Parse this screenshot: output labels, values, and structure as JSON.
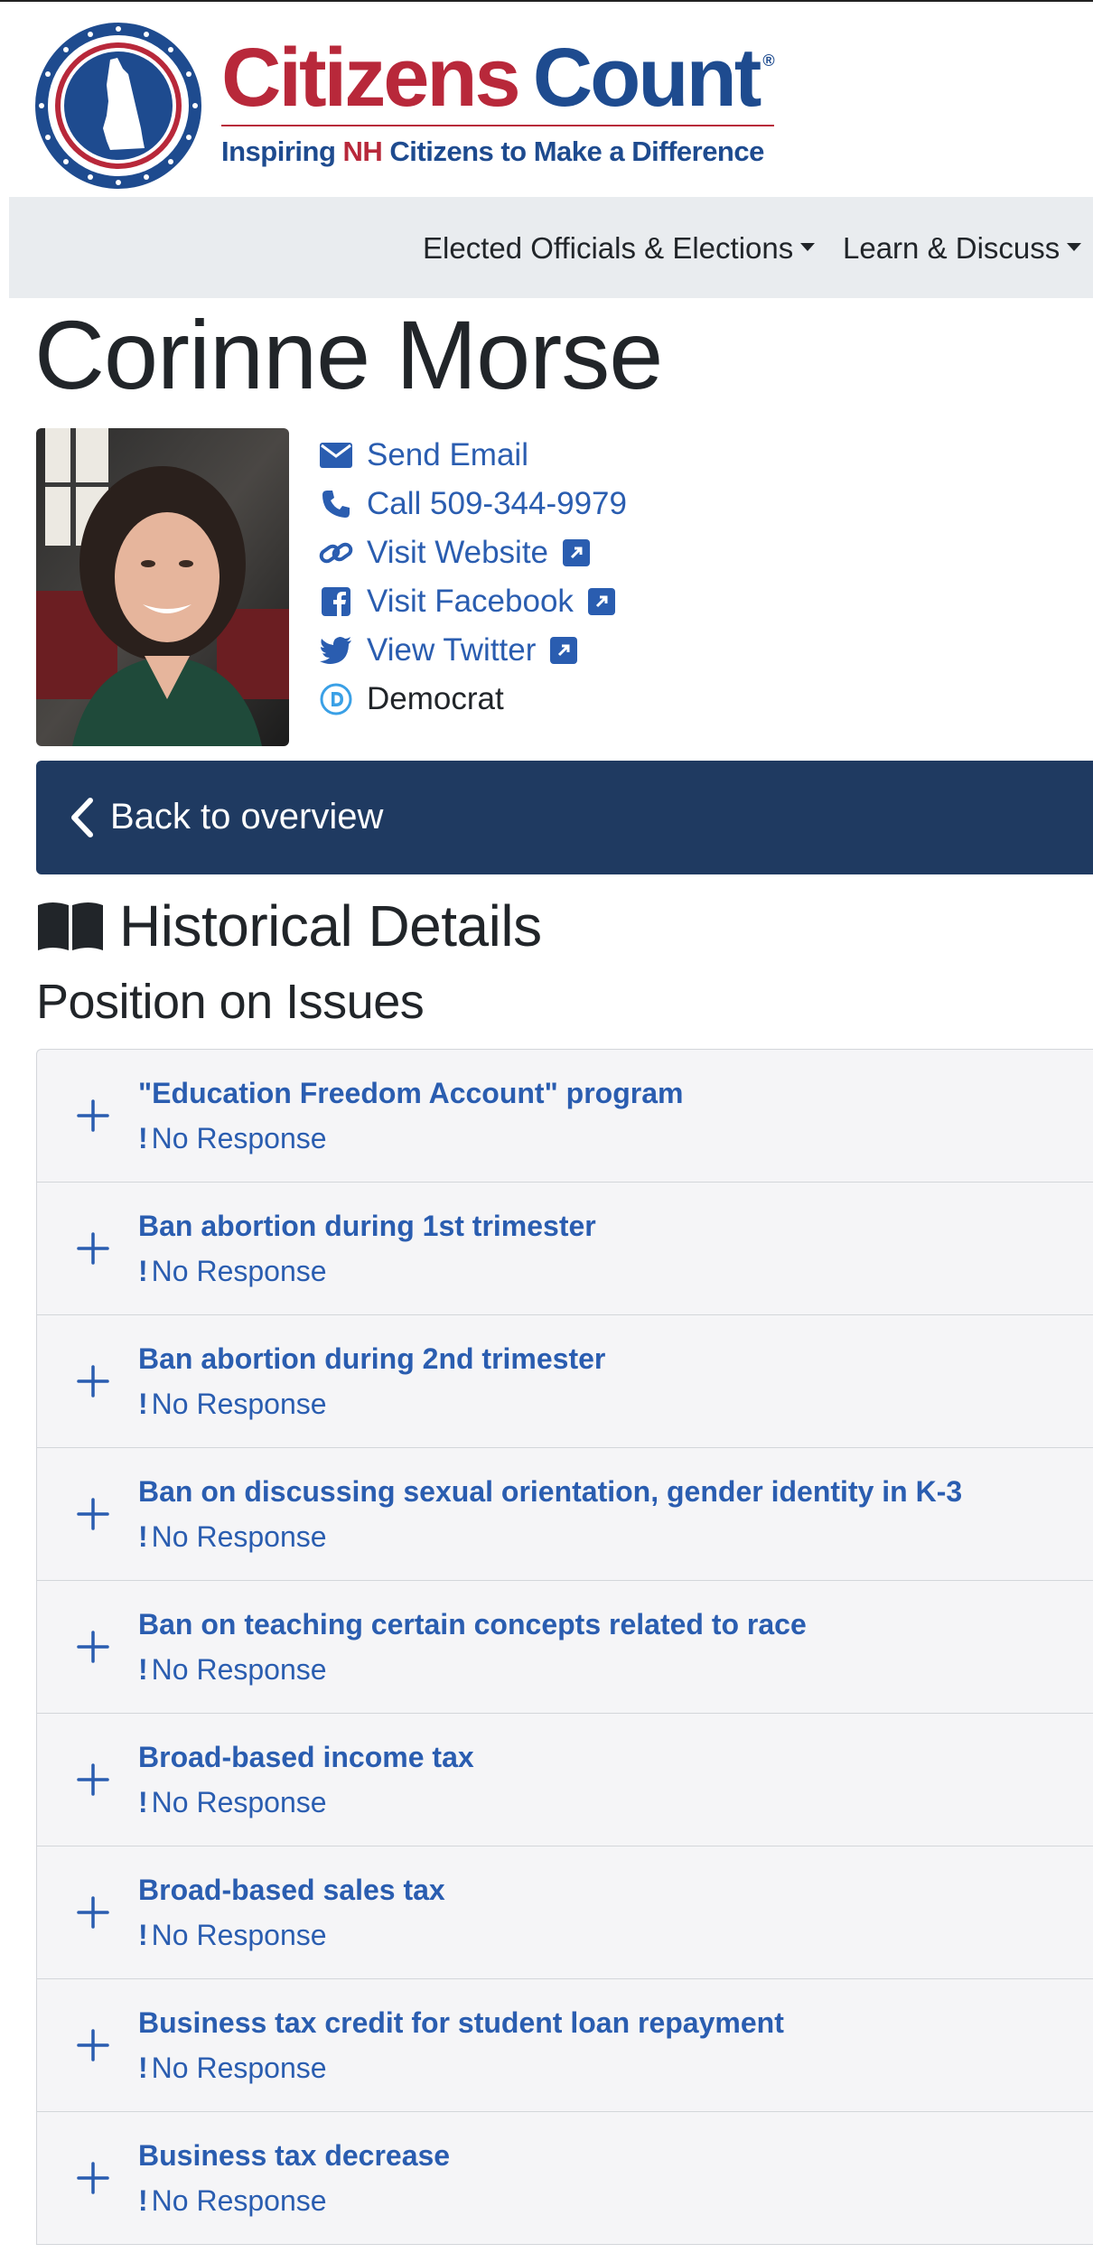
{
  "brand": {
    "name_part1": "Citizens",
    "name_part2": "Count",
    "registered": "®",
    "tagline_before": "Inspiring ",
    "tagline_nh": "NH",
    "tagline_after": " Citizens to Make a Difference",
    "colors": {
      "red": "#b8283a",
      "blue": "#1e4b8f"
    }
  },
  "nav": {
    "elected": "Elected Officials & Elections",
    "learn": "Learn & Discuss"
  },
  "person": {
    "name": "Corinne Morse",
    "contacts": {
      "email": "Send Email",
      "call": "Call 509-344-9979",
      "website": "Visit Website",
      "facebook": "Visit Facebook",
      "twitter": "View Twitter",
      "party": "Democrat"
    }
  },
  "back_label": "Back to overview",
  "historical_title": "Historical Details",
  "positions_heading": "Position on Issues",
  "response_mark": "!",
  "issues": [
    {
      "title": "\"Education Freedom Account\" program",
      "response": "No Response"
    },
    {
      "title": "Ban abortion during 1st trimester",
      "response": "No Response"
    },
    {
      "title": "Ban abortion during 2nd trimester",
      "response": "No Response"
    },
    {
      "title": "Ban on discussing sexual orientation, gender identity in K-3",
      "response": "No Response"
    },
    {
      "title": "Ban on teaching certain concepts related to race",
      "response": "No Response"
    },
    {
      "title": "Broad-based income tax",
      "response": "No Response"
    },
    {
      "title": "Broad-based sales tax",
      "response": "No Response"
    },
    {
      "title": "Business tax credit for student loan repayment",
      "response": "No Response"
    },
    {
      "title": "Business tax decrease",
      "response": "No Response"
    }
  ],
  "colors": {
    "link": "#2a5db0",
    "backbar": "#1f3a61",
    "nav_bg": "#e9ecef",
    "accordion_bg": "#f5f5f7"
  }
}
